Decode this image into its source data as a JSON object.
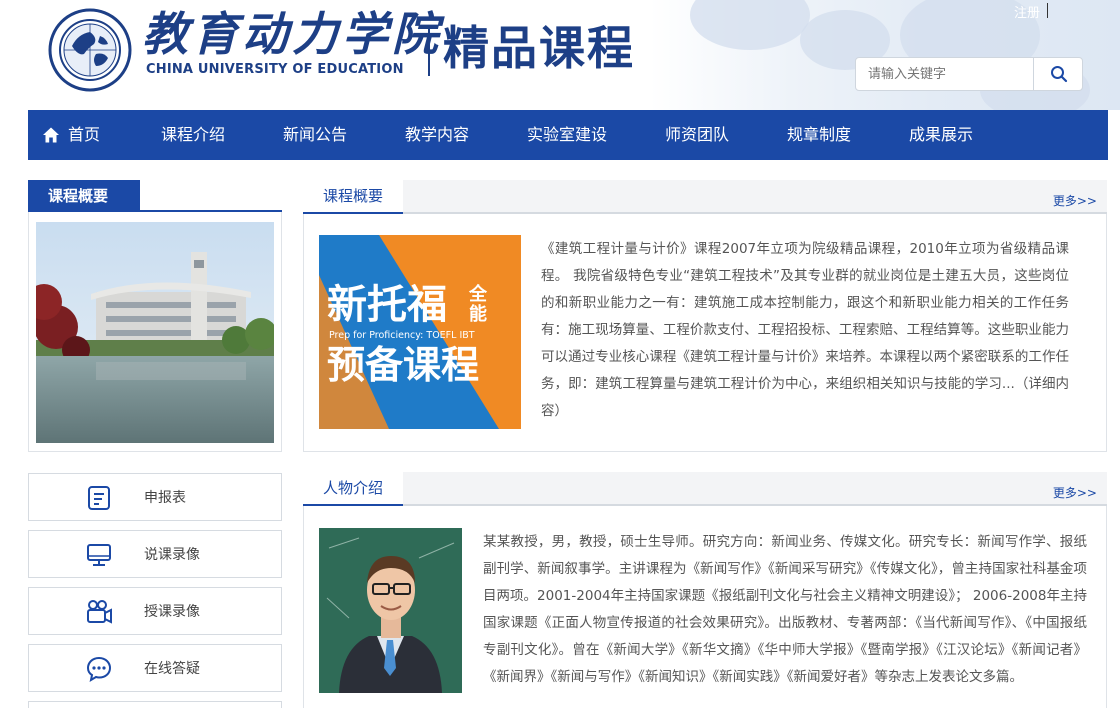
{
  "header": {
    "logo_cn": "教育动力学院",
    "logo_en": "CHINA UNIVERSITY OF EDUCATION",
    "course_title": "精品课程",
    "register_link": "注册",
    "search_placeholder": "请输入关键字"
  },
  "nav": {
    "items": [
      {
        "label": "首页"
      },
      {
        "label": "课程介绍"
      },
      {
        "label": "新闻公告"
      },
      {
        "label": "教学内容"
      },
      {
        "label": "实验室建设"
      },
      {
        "label": "师资团队"
      },
      {
        "label": "规章制度"
      },
      {
        "label": "成果展示"
      }
    ]
  },
  "sidebar": {
    "title": "课程概要",
    "buttons": [
      {
        "label": "申报表",
        "icon": "document-icon"
      },
      {
        "label": "说课录像",
        "icon": "monitor-icon"
      },
      {
        "label": "授课录像",
        "icon": "camera-icon"
      },
      {
        "label": "在线答疑",
        "icon": "chat-icon"
      }
    ]
  },
  "overview": {
    "title": "课程概要",
    "more": "更多>>",
    "promo_big1": "新托福",
    "promo_small": "全能",
    "promo_en": "Prep for Proficiency: TOEFL IBT",
    "promo_big2": "预备课程",
    "text": "《建筑工程计量与计价》课程2007年立项为院级精品课程，2010年立项为省级精品课程。 我院省级特色专业“建筑工程技术”及其专业群的就业岗位是土建五大员，这些岗位的和新职业能力之一有：建筑施工成本控制能力，跟这个和新职业能力相关的工作任务有：施工现场算量、工程价款支付、工程招投标、工程索赔、工程结算等。这些职业能力可以通过专业核心课程《建筑工程计量与计价》来培养。本课程以两个紧密联系的工作任务，即：建筑工程算量与建筑工程计价为中心，来组织相关知识与技能的学习...（详细内容）"
  },
  "people": {
    "title": "人物介绍",
    "more": "更多>>",
    "text": "某某教授，男，教授，硕士生导师。研究方向：新闻业务、传媒文化。研究专长：新闻写作学、报纸副刊学、新闻叙事学。主讲课程为《新闻写作》《新闻采写研究》《传媒文化》，曾主持国家社科基金项目两项。2001-2004年主持国家课题《报纸副刊文化与社会主义精神文明建设》； 2006-2008年主持国家课题《正面人物宣传报道的社会效果研究》。出版教材、专著两部：《当代新闻写作》、《中国报纸专副刊文化》。曾在《新闻大学》《新华文摘》《华中师大学报》《暨南学报》《江汉论坛》《新闻记者》《新闻界》《新闻与写作》《新闻知识》《新闻实践》《新闻爱好者》等杂志上发表论文多篇。"
  },
  "colors": {
    "primary": "#1b49a6",
    "logo": "#1d3f86",
    "promo_blue": "#1f7bc8",
    "promo_orange": "#f08a24"
  }
}
